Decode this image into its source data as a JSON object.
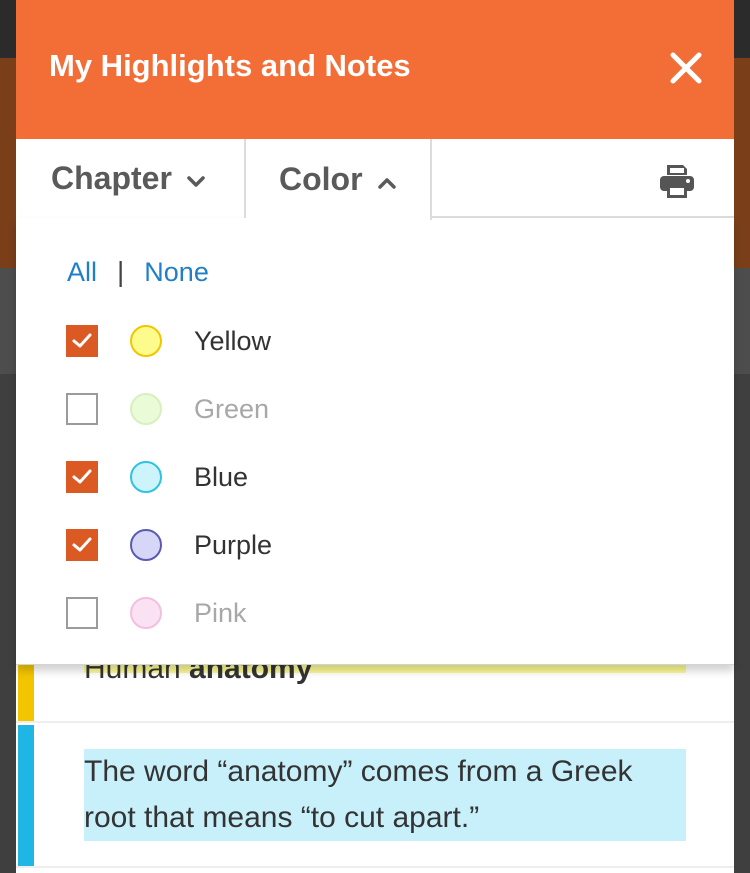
{
  "modal": {
    "title": "My Highlights and Notes",
    "close_icon": "close-icon"
  },
  "tabs": {
    "chapter_label": "Chapter",
    "color_label": "Color",
    "print_icon": "print-icon"
  },
  "filter": {
    "all_label": "All",
    "separator": "|",
    "none_label": "None",
    "colors": [
      {
        "label": "Yellow",
        "checked": true,
        "fill": "#fdfb8c",
        "border": "#f2c500"
      },
      {
        "label": "Green",
        "checked": false,
        "fill": "#eafbd8",
        "border": "#d8efc0"
      },
      {
        "label": "Blue",
        "checked": true,
        "fill": "#cdf3fb",
        "border": "#2ec2e3"
      },
      {
        "label": "Purple",
        "checked": true,
        "fill": "#d6d6f7",
        "border": "#5a5ab5"
      },
      {
        "label": "Pink",
        "checked": false,
        "fill": "#fbe2f2",
        "border": "#f3bfe0"
      }
    ]
  },
  "notes": [
    {
      "text_plain": "Human ",
      "text_bold": "anatomy",
      "stripe": "#f2c500",
      "highlight": "#fcfa94"
    },
    {
      "text_plain": "The word “anatomy” comes from a Greek root that means “to cut apart.”",
      "text_bold": "",
      "stripe": "#1fb6e6",
      "highlight": "#c8f0fb"
    }
  ],
  "colors": {
    "accent": "#f36d36",
    "checkbox": "#db5a24",
    "link": "#1f7fc7"
  }
}
